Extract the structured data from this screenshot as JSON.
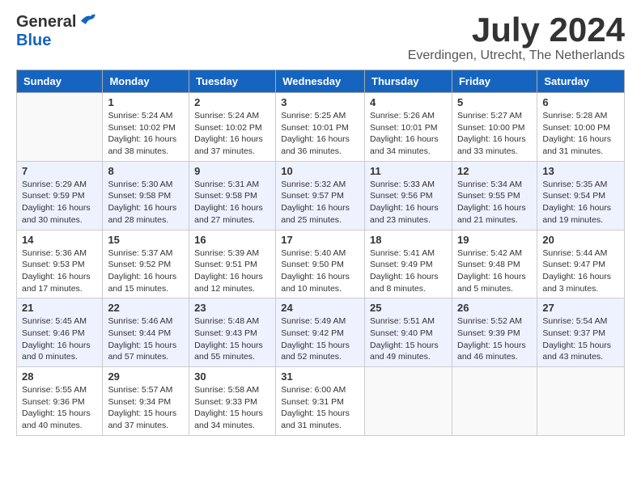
{
  "header": {
    "logo_general": "General",
    "logo_blue": "Blue",
    "month_year": "July 2024",
    "location": "Everdingen, Utrecht, The Netherlands"
  },
  "weekdays": [
    "Sunday",
    "Monday",
    "Tuesday",
    "Wednesday",
    "Thursday",
    "Friday",
    "Saturday"
  ],
  "weeks": [
    [
      {
        "day": "",
        "info": ""
      },
      {
        "day": "1",
        "info": "Sunrise: 5:24 AM\nSunset: 10:02 PM\nDaylight: 16 hours\nand 38 minutes."
      },
      {
        "day": "2",
        "info": "Sunrise: 5:24 AM\nSunset: 10:02 PM\nDaylight: 16 hours\nand 37 minutes."
      },
      {
        "day": "3",
        "info": "Sunrise: 5:25 AM\nSunset: 10:01 PM\nDaylight: 16 hours\nand 36 minutes."
      },
      {
        "day": "4",
        "info": "Sunrise: 5:26 AM\nSunset: 10:01 PM\nDaylight: 16 hours\nand 34 minutes."
      },
      {
        "day": "5",
        "info": "Sunrise: 5:27 AM\nSunset: 10:00 PM\nDaylight: 16 hours\nand 33 minutes."
      },
      {
        "day": "6",
        "info": "Sunrise: 5:28 AM\nSunset: 10:00 PM\nDaylight: 16 hours\nand 31 minutes."
      }
    ],
    [
      {
        "day": "7",
        "info": "Sunrise: 5:29 AM\nSunset: 9:59 PM\nDaylight: 16 hours\nand 30 minutes."
      },
      {
        "day": "8",
        "info": "Sunrise: 5:30 AM\nSunset: 9:58 PM\nDaylight: 16 hours\nand 28 minutes."
      },
      {
        "day": "9",
        "info": "Sunrise: 5:31 AM\nSunset: 9:58 PM\nDaylight: 16 hours\nand 27 minutes."
      },
      {
        "day": "10",
        "info": "Sunrise: 5:32 AM\nSunset: 9:57 PM\nDaylight: 16 hours\nand 25 minutes."
      },
      {
        "day": "11",
        "info": "Sunrise: 5:33 AM\nSunset: 9:56 PM\nDaylight: 16 hours\nand 23 minutes."
      },
      {
        "day": "12",
        "info": "Sunrise: 5:34 AM\nSunset: 9:55 PM\nDaylight: 16 hours\nand 21 minutes."
      },
      {
        "day": "13",
        "info": "Sunrise: 5:35 AM\nSunset: 9:54 PM\nDaylight: 16 hours\nand 19 minutes."
      }
    ],
    [
      {
        "day": "14",
        "info": "Sunrise: 5:36 AM\nSunset: 9:53 PM\nDaylight: 16 hours\nand 17 minutes."
      },
      {
        "day": "15",
        "info": "Sunrise: 5:37 AM\nSunset: 9:52 PM\nDaylight: 16 hours\nand 15 minutes."
      },
      {
        "day": "16",
        "info": "Sunrise: 5:39 AM\nSunset: 9:51 PM\nDaylight: 16 hours\nand 12 minutes."
      },
      {
        "day": "17",
        "info": "Sunrise: 5:40 AM\nSunset: 9:50 PM\nDaylight: 16 hours\nand 10 minutes."
      },
      {
        "day": "18",
        "info": "Sunrise: 5:41 AM\nSunset: 9:49 PM\nDaylight: 16 hours\nand 8 minutes."
      },
      {
        "day": "19",
        "info": "Sunrise: 5:42 AM\nSunset: 9:48 PM\nDaylight: 16 hours\nand 5 minutes."
      },
      {
        "day": "20",
        "info": "Sunrise: 5:44 AM\nSunset: 9:47 PM\nDaylight: 16 hours\nand 3 minutes."
      }
    ],
    [
      {
        "day": "21",
        "info": "Sunrise: 5:45 AM\nSunset: 9:46 PM\nDaylight: 16 hours\nand 0 minutes."
      },
      {
        "day": "22",
        "info": "Sunrise: 5:46 AM\nSunset: 9:44 PM\nDaylight: 15 hours\nand 57 minutes."
      },
      {
        "day": "23",
        "info": "Sunrise: 5:48 AM\nSunset: 9:43 PM\nDaylight: 15 hours\nand 55 minutes."
      },
      {
        "day": "24",
        "info": "Sunrise: 5:49 AM\nSunset: 9:42 PM\nDaylight: 15 hours\nand 52 minutes."
      },
      {
        "day": "25",
        "info": "Sunrise: 5:51 AM\nSunset: 9:40 PM\nDaylight: 15 hours\nand 49 minutes."
      },
      {
        "day": "26",
        "info": "Sunrise: 5:52 AM\nSunset: 9:39 PM\nDaylight: 15 hours\nand 46 minutes."
      },
      {
        "day": "27",
        "info": "Sunrise: 5:54 AM\nSunset: 9:37 PM\nDaylight: 15 hours\nand 43 minutes."
      }
    ],
    [
      {
        "day": "28",
        "info": "Sunrise: 5:55 AM\nSunset: 9:36 PM\nDaylight: 15 hours\nand 40 minutes."
      },
      {
        "day": "29",
        "info": "Sunrise: 5:57 AM\nSunset: 9:34 PM\nDaylight: 15 hours\nand 37 minutes."
      },
      {
        "day": "30",
        "info": "Sunrise: 5:58 AM\nSunset: 9:33 PM\nDaylight: 15 hours\nand 34 minutes."
      },
      {
        "day": "31",
        "info": "Sunrise: 6:00 AM\nSunset: 9:31 PM\nDaylight: 15 hours\nand 31 minutes."
      },
      {
        "day": "",
        "info": ""
      },
      {
        "day": "",
        "info": ""
      },
      {
        "day": "",
        "info": ""
      }
    ]
  ]
}
